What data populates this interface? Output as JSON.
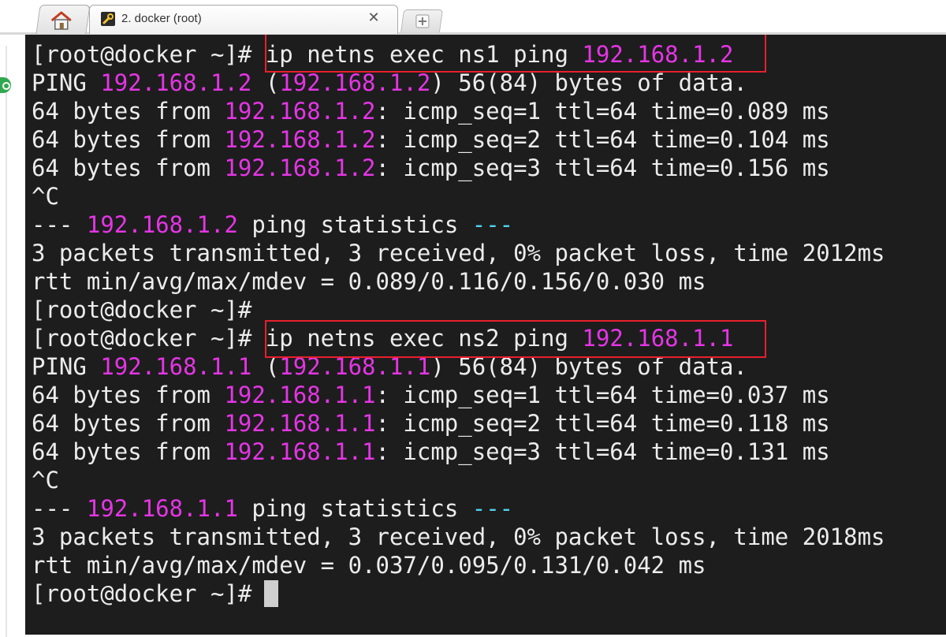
{
  "tabs": {
    "home_icon": "home-icon",
    "session_icon": "wrench-icon",
    "session_title": "2. docker (root)",
    "close_glyph": "✕",
    "new_tab_icon": "plus-icon"
  },
  "colors": {
    "terminal_bg": "#1d1d1d",
    "text": "#ececec",
    "ip_highlight": "#e535e5",
    "statistics_dash": "#4fd6f0",
    "annotation_box": "#e8202c"
  },
  "terminal": {
    "prompt": "[root@docker ~]#",
    "ping_prefix": "PING ",
    "session1": {
      "command": "ip netns exec ns1 ping ",
      "target": "192.168.1.2",
      "header_rest": "56(84) bytes of data.",
      "replies": [
        {
          "prefix": "64 bytes from ",
          "ip": "192.168.1.2",
          "rest": ": icmp_seq=1 ttl=64 time=0.089 ms"
        },
        {
          "prefix": "64 bytes from ",
          "ip": "192.168.1.2",
          "rest": ": icmp_seq=2 ttl=64 time=0.104 ms"
        },
        {
          "prefix": "64 bytes from ",
          "ip": "192.168.1.2",
          "rest": ": icmp_seq=3 ttl=64 time=0.156 ms"
        }
      ],
      "interrupt": "^C",
      "stats_header_suffix": " ping statistics ",
      "stats_dashes": "---",
      "packets": "3 packets transmitted, 3 received, 0% packet loss, time 2012ms",
      "rtt": "rtt min/avg/max/mdev = 0.089/0.116/0.156/0.030 ms"
    },
    "session2": {
      "command": "ip netns exec ns2 ping ",
      "target": "192.168.1.1",
      "header_rest": "56(84) bytes of data.",
      "replies": [
        {
          "prefix": "64 bytes from ",
          "ip": "192.168.1.1",
          "rest": ": icmp_seq=1 ttl=64 time=0.037 ms"
        },
        {
          "prefix": "64 bytes from ",
          "ip": "192.168.1.1",
          "rest": ": icmp_seq=2 ttl=64 time=0.118 ms"
        },
        {
          "prefix": "64 bytes from ",
          "ip": "192.168.1.1",
          "rest": ": icmp_seq=3 ttl=64 time=0.131 ms"
        }
      ],
      "interrupt": "^C",
      "stats_header_suffix": " ping statistics ",
      "stats_dashes": "---",
      "packets": "3 packets transmitted, 3 received, 0% packet loss, time 2018ms",
      "rtt": "rtt min/avg/max/mdev = 0.037/0.095/0.131/0.042 ms"
    }
  }
}
